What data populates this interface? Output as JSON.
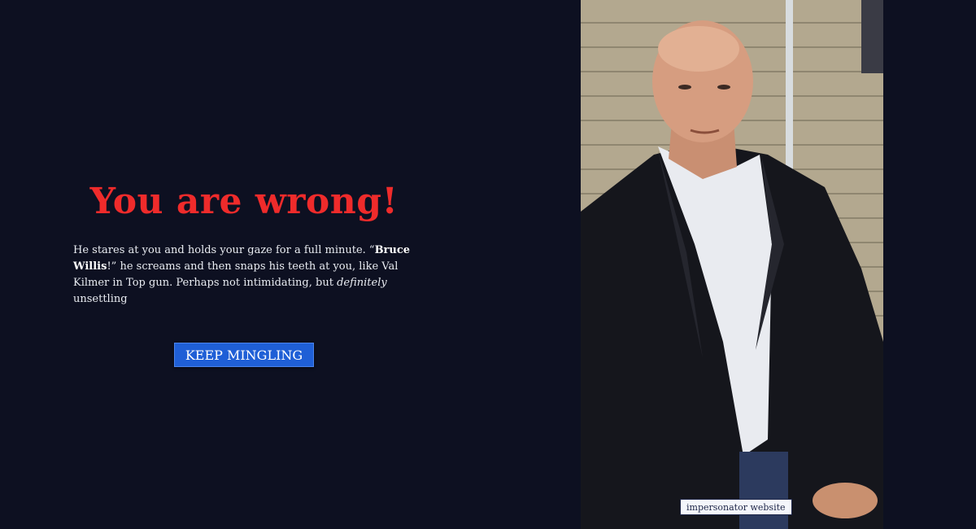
{
  "result": {
    "headline": "You are wrong!",
    "story": {
      "part1": "He stares at you and holds your gaze for a full minute. “",
      "name": "Bruce Willis",
      "part2": "!” he screams and then snaps his teeth at you, like Val Kilmer in Top gun. Perhaps not intimidating, but ",
      "emphasis": "definitely",
      "part3": " unsettling"
    },
    "button_label": "KEEP MINGLING"
  },
  "photo": {
    "credit_link": "impersonator website"
  },
  "colors": {
    "background": "#0d1021",
    "headline": "#ef2b2b",
    "button": "#1f5fd6",
    "text": "#e9ecf2"
  }
}
